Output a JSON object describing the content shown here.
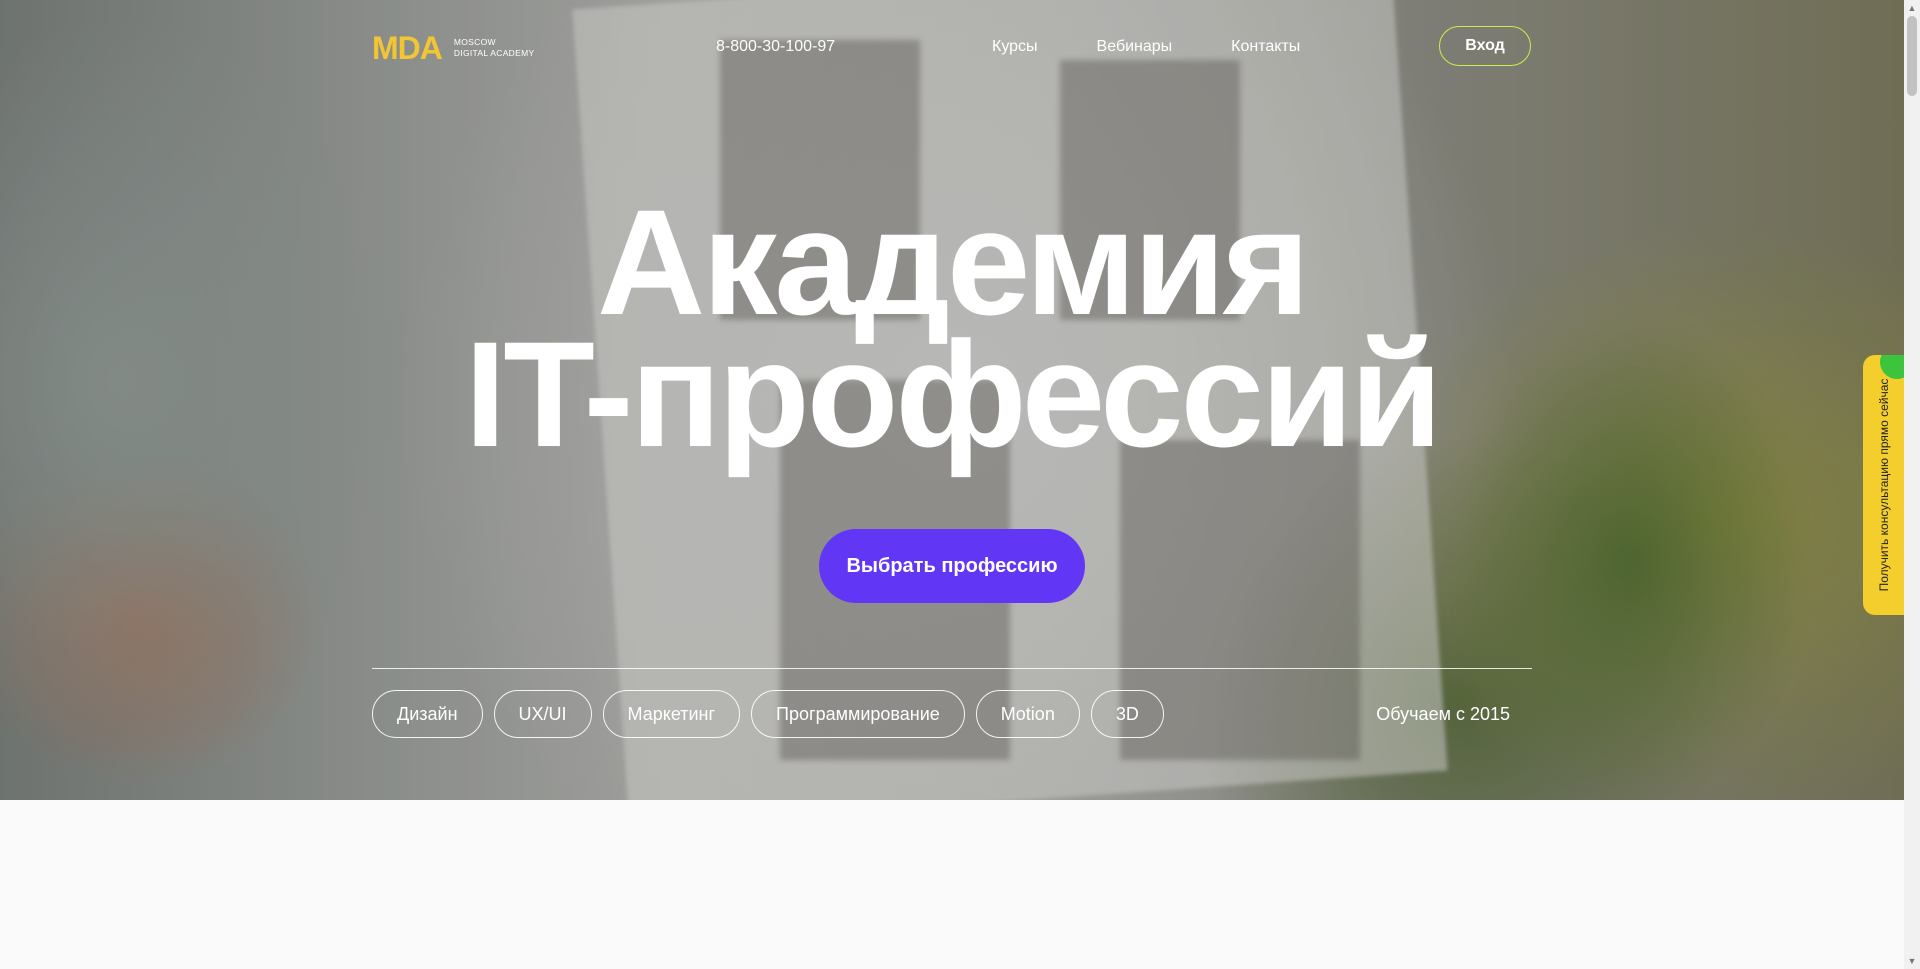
{
  "header": {
    "logo_mark": "MDA",
    "logo_line1": "MOSCOW",
    "logo_line2": "DIGITAL ACADEMY",
    "phone": "8-800-30-100-97",
    "nav": [
      "Курсы",
      "Вебинары",
      "Контакты"
    ],
    "login_label": "Вход"
  },
  "hero": {
    "title_line1": "Академия",
    "title_line2": "IT-профессий",
    "cta_label": "Выбрать профессию",
    "tags": [
      "Дизайн",
      "UX/UI",
      "Маркетинг",
      "Программирование",
      "Motion",
      "3D"
    ],
    "since": "Обучаем с 2015"
  },
  "side_tab": {
    "label": "Получить консультацию прямо сейчас"
  },
  "colors": {
    "accent": "#6236f5",
    "logo": "#f2c535",
    "login_border": "#c8f04a",
    "side_tab": "#f4ce2c"
  }
}
